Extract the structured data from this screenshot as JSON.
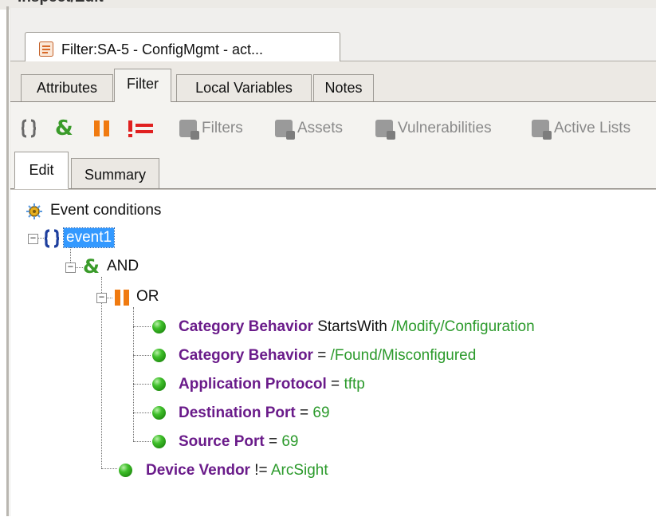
{
  "window": {
    "title": "Inspect/Edit"
  },
  "editor_tab": {
    "label": "Filter:SA-5 - ConfigMgmt - act..."
  },
  "main_tabs": [
    "Attributes",
    "Filter",
    "Local Variables",
    "Notes"
  ],
  "main_tabs_active": "Filter",
  "toolbar": {
    "buttons": [
      {
        "icon": "braces-icon",
        "label": ""
      },
      {
        "icon": "and-icon",
        "label": ""
      },
      {
        "icon": "or-icon",
        "label": ""
      },
      {
        "icon": "not-equal-icon",
        "label": ""
      },
      {
        "icon": "filters-icon",
        "label": "Filters"
      },
      {
        "icon": "assets-icon",
        "label": "Assets"
      },
      {
        "icon": "vulnerabilities-icon",
        "label": "Vulnerabilities"
      },
      {
        "icon": "active-lists-icon",
        "label": "Active Lists"
      }
    ]
  },
  "inner_tabs": [
    "Edit",
    "Summary"
  ],
  "inner_tabs_active": "Edit",
  "tree": {
    "root": {
      "label": "Event conditions"
    },
    "event": {
      "label": "event1"
    },
    "and_node": {
      "label": "AND"
    },
    "or_node": {
      "label": "OR"
    },
    "conditions": [
      {
        "field": "Category Behavior",
        "operator": " StartsWith ",
        "value": "/Modify/Configuration"
      },
      {
        "field": "Category Behavior",
        "operator": " = ",
        "value": "/Found/Misconfigured"
      },
      {
        "field": "Application Protocol",
        "operator": " = ",
        "value": "tftp"
      },
      {
        "field": "Destination Port",
        "operator": " = ",
        "value": "69"
      },
      {
        "field": "Source Port",
        "operator": " = ",
        "value": "69"
      }
    ],
    "device_vendor": {
      "field": "Device Vendor",
      "operator": " != ",
      "value": "ArcSight"
    }
  },
  "colors": {
    "field": "#6a1b8a",
    "value": "#2b9a2b",
    "selection": "#3399ff",
    "and_icon": "#3a9b2a",
    "or_icon": "#f07a10",
    "not_equal_icon": "#e02020",
    "braces_icon": "#1e3f9e"
  }
}
